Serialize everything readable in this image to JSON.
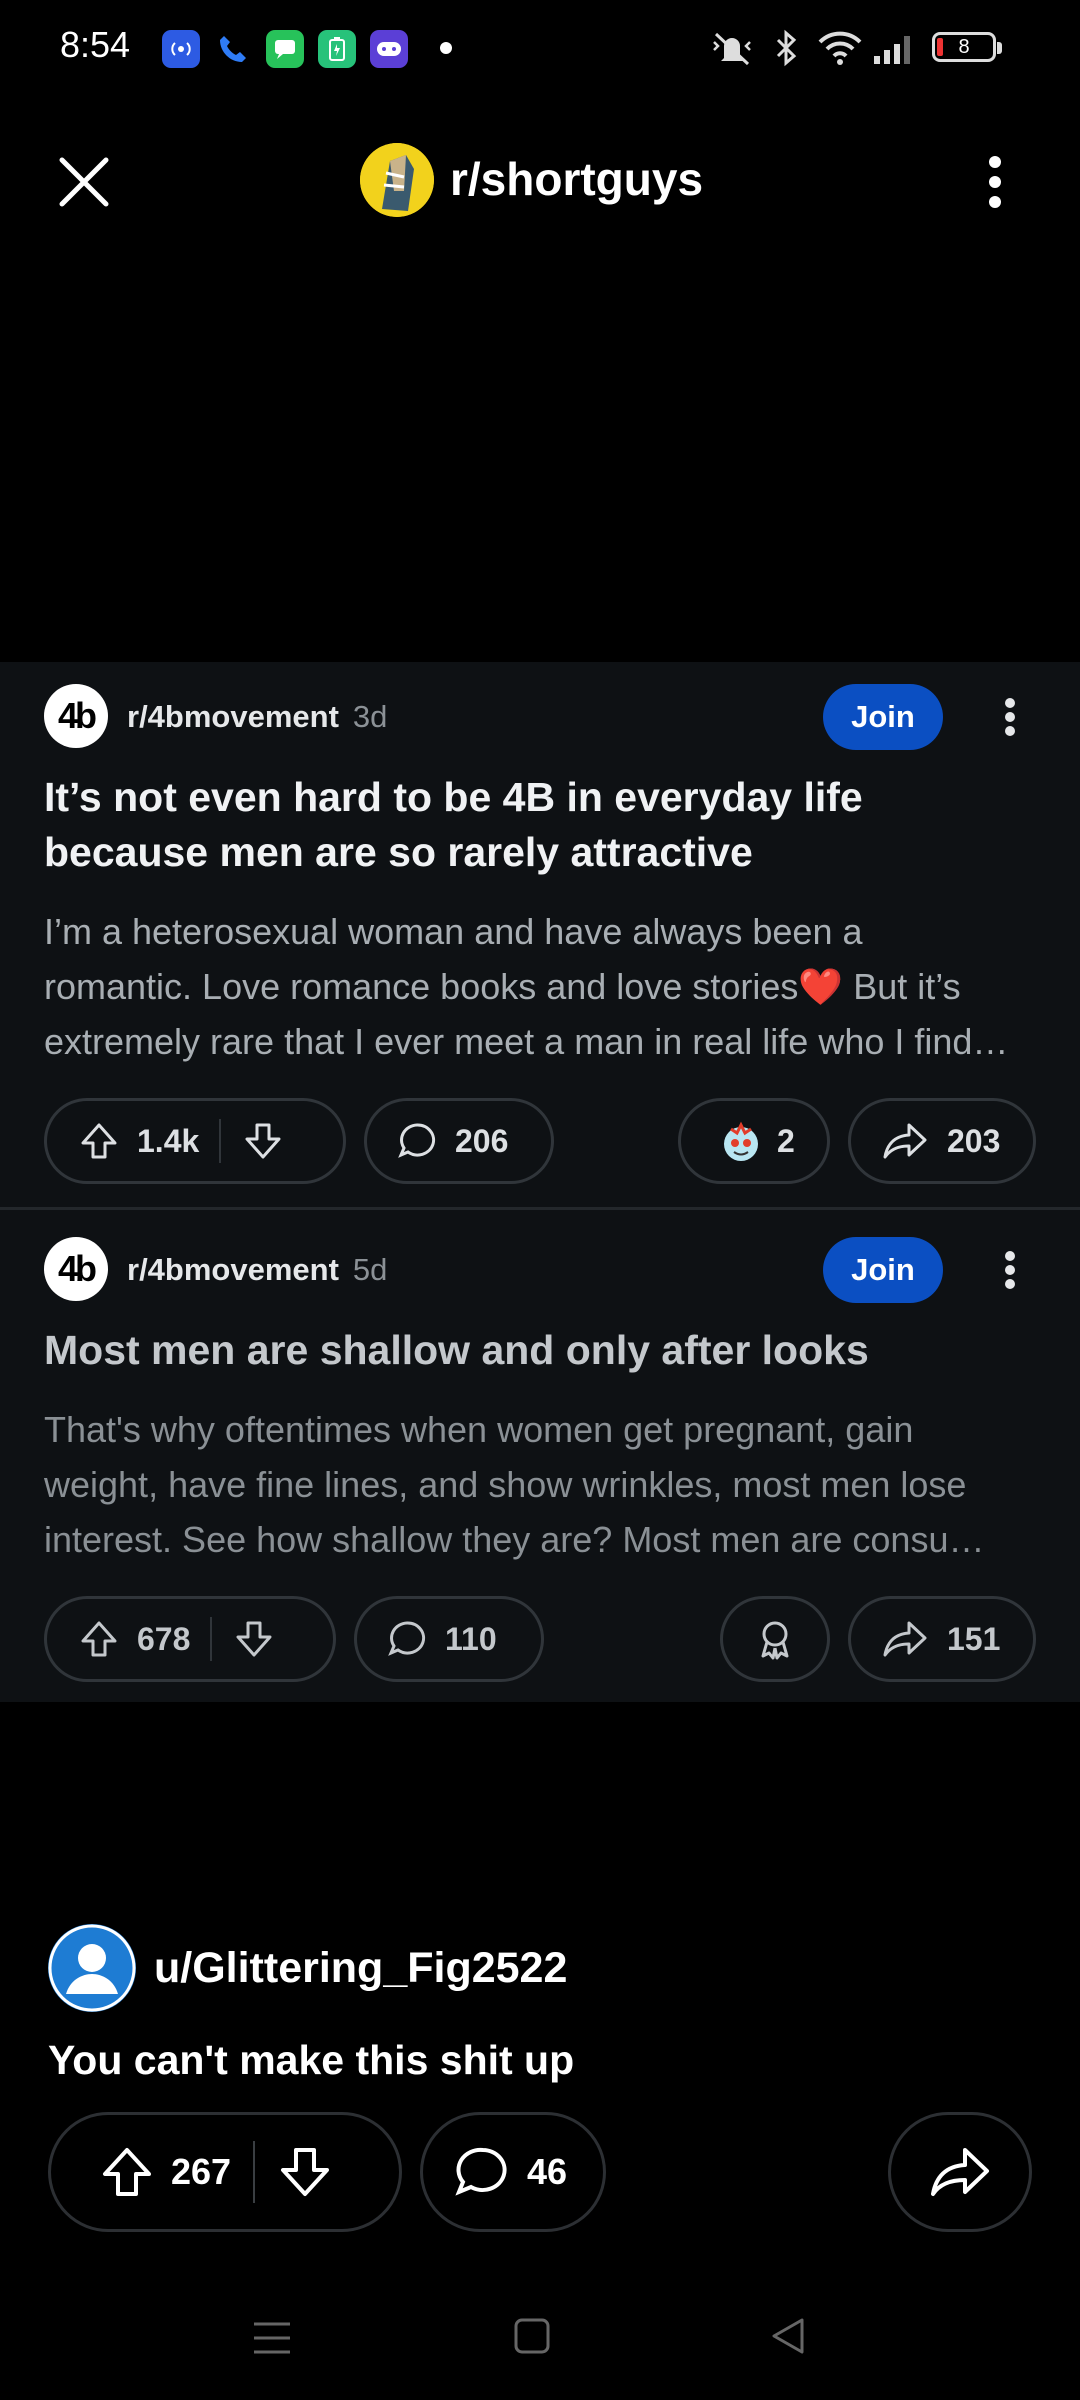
{
  "status_bar": {
    "time": "8:54",
    "battery": "8",
    "icons": [
      "hotspot-icon",
      "phone-icon",
      "messages-icon",
      "battery-saver-icon",
      "game-icon",
      "notification-dot",
      "vibrate-icon",
      "bluetooth-icon",
      "wifi-icon",
      "signal-icon",
      "battery-icon"
    ]
  },
  "header": {
    "subreddit": "r/shortguys"
  },
  "embed": {
    "posts": [
      {
        "avatar_text": "4b",
        "subreddit": "r/4bmovement",
        "age": "3d",
        "join_label": "Join",
        "title": "It’s not even hard to be 4B in everyday life because men are so rarely attractive",
        "body_lines": [
          "I’m a heterosexual woman and have always been a",
          "romantic. Love romance books and love stories❤️ But it’s",
          "extremely rare that I ever meet a man in real life who I find…"
        ],
        "votes": "1.4k",
        "comments": "206",
        "awards": "2",
        "shares": "203"
      },
      {
        "avatar_text": "4b",
        "subreddit": "r/4bmovement",
        "age": "5d",
        "join_label": "Join",
        "title": "Most men are shallow and only after looks",
        "body_lines": [
          "That's why oftentimes when women get pregnant, gain",
          "weight, have fine lines, and show wrinkles, most men lose",
          "interest. See how shallow they are? Most men are consu…"
        ],
        "votes": "678",
        "comments": "110",
        "awards": "",
        "shares": "151"
      }
    ]
  },
  "op": {
    "user": "u/Glittering_Fig2522",
    "title": "You can't make this shit up",
    "votes": "267",
    "comments": "46"
  },
  "colors": {
    "join": "#0b4fc2",
    "avatar_blue": "#1e7cd3",
    "card_bg": "#0e1114"
  }
}
